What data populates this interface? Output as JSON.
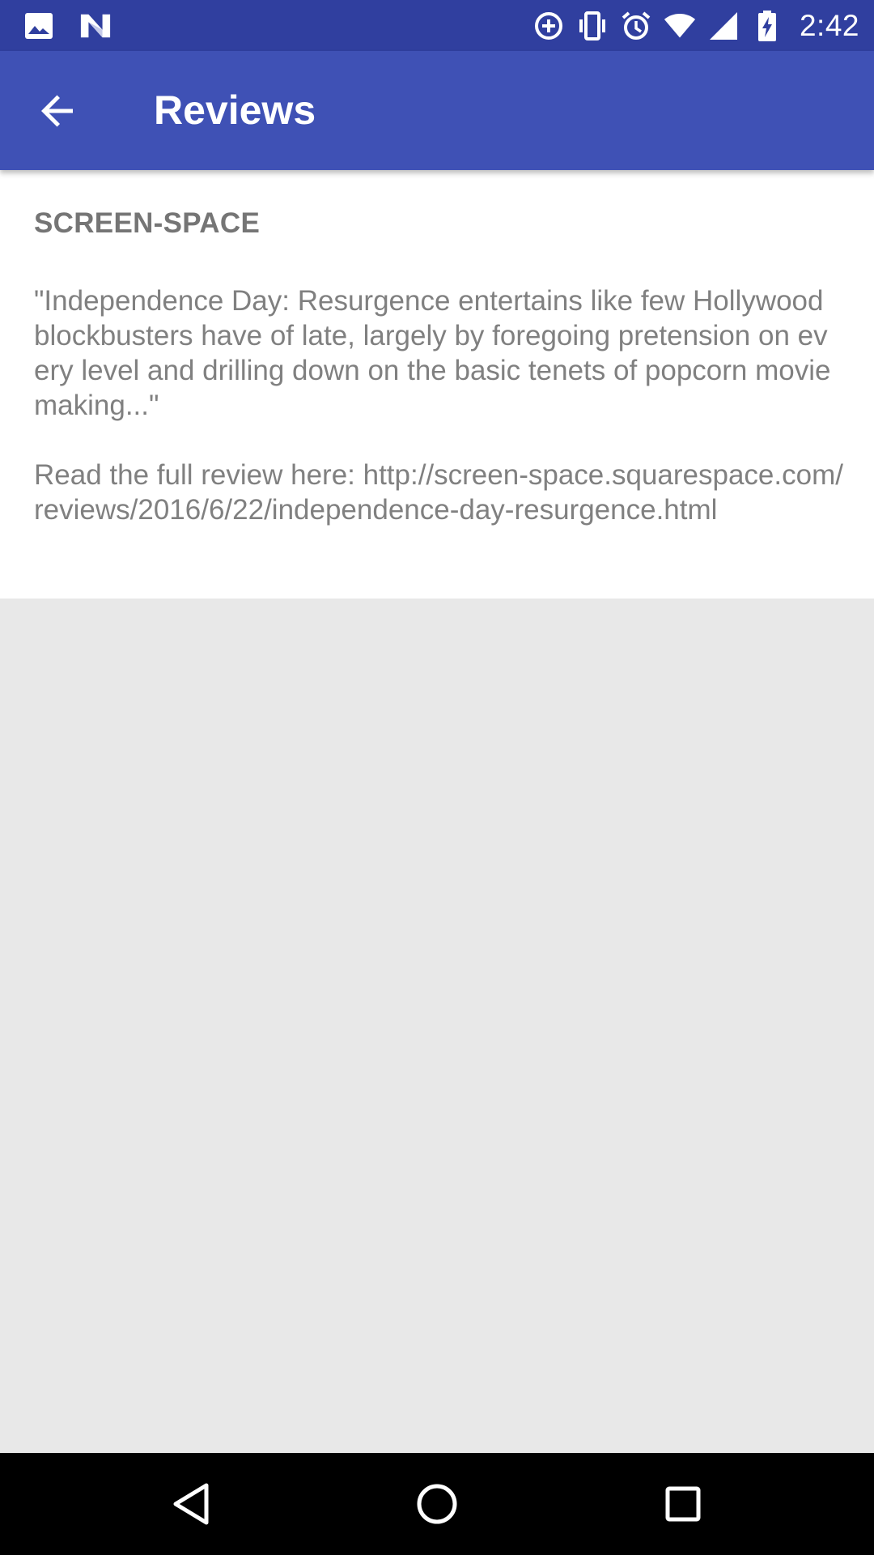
{
  "status_bar": {
    "time": "2:42",
    "left_icons": [
      "image-icon",
      "n-app-icon"
    ],
    "right_icons": [
      "data-saver-icon",
      "vibrate-icon",
      "alarm-icon",
      "wifi-icon",
      "cell-signal-icon",
      "battery-charging-icon"
    ],
    "background": "#303f9f"
  },
  "app_bar": {
    "title": "Reviews",
    "back_icon": "arrow-back-icon",
    "background": "#3f51b5"
  },
  "review": {
    "source": "SCREEN-SPACE",
    "body": "\"Independence Day: Resurgence entertains like few Hollywood blockbusters have of late, largely by foregoing pretension on every level and drilling down on the basic tenets of popcorn moviemaking...\"\n\nRead the full review here: http://screen-space.squarespace.com/reviews/2016/6/22/independence-day-resurgence.html"
  },
  "nav_bar": {
    "back_icon": "triangle-back-icon",
    "home_icon": "circle-home-icon",
    "recents_icon": "square-recents-icon"
  },
  "colors": {
    "page_background": "#e8e8e8",
    "card_background": "#ffffff",
    "text_gray": "#808080"
  }
}
